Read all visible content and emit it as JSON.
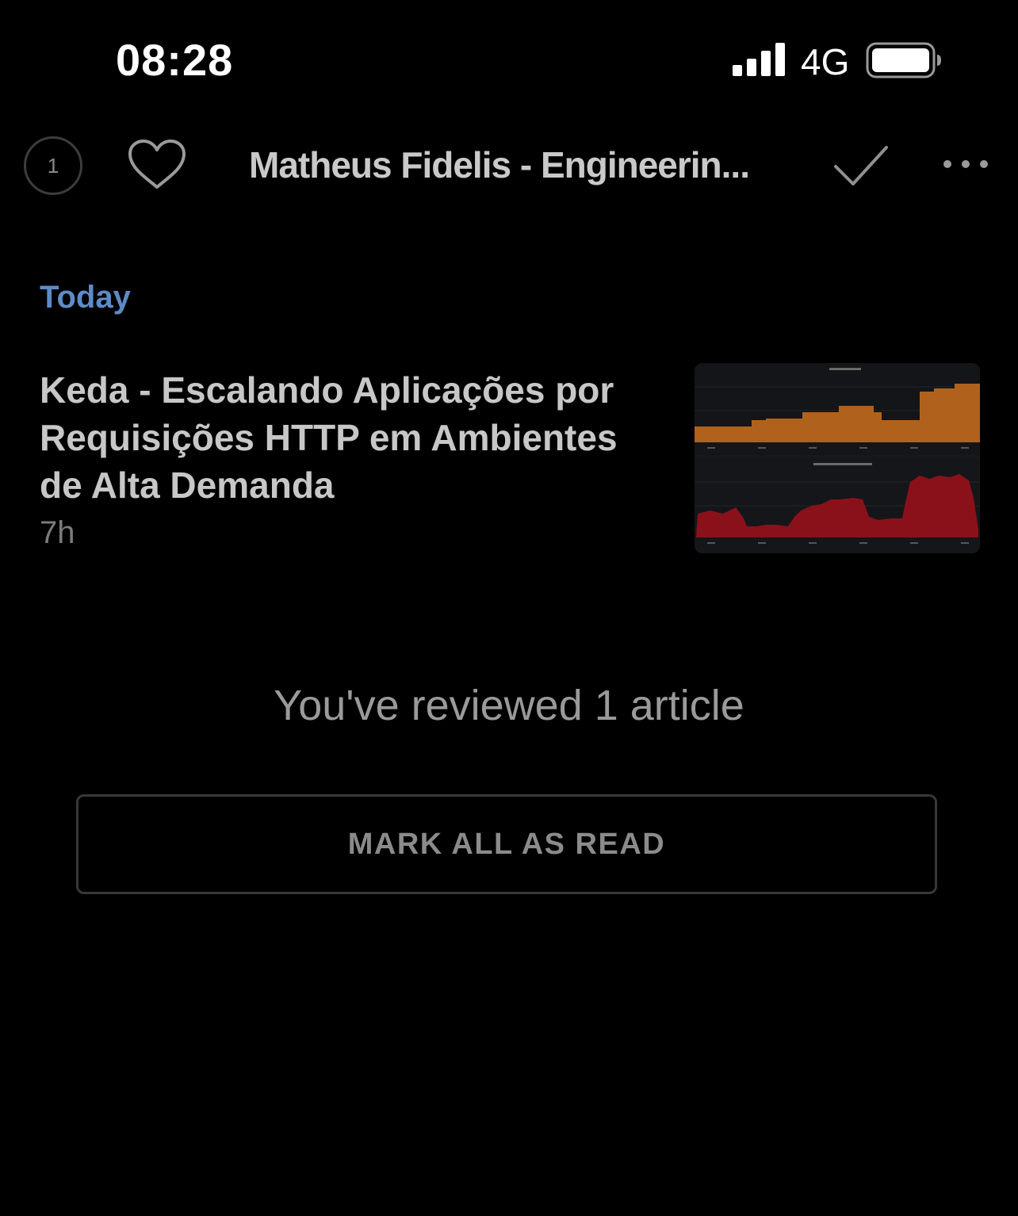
{
  "status_bar": {
    "time": "08:28",
    "network": "4G",
    "icons": [
      "signal-icon",
      "battery-icon"
    ]
  },
  "toolbar": {
    "unread_count": "1",
    "title": "Matheus Fidelis - Engineerin...",
    "icons": [
      "heart-icon",
      "check-icon",
      "more-icon"
    ]
  },
  "section": {
    "label": "Today"
  },
  "articles": [
    {
      "title": "Keda - Escalando Aplicações por Requisições HTTP em Ambientes de Alta Demanda",
      "age": "7h"
    }
  ],
  "summary": {
    "reviewed_text": "You've reviewed 1 article",
    "mark_all_label": "MARK ALL AS READ"
  },
  "colors": {
    "background": "#000000",
    "section_accent": "#5e8bc8",
    "chart_orange": "#b0621d",
    "chart_red": "#8a1119"
  }
}
